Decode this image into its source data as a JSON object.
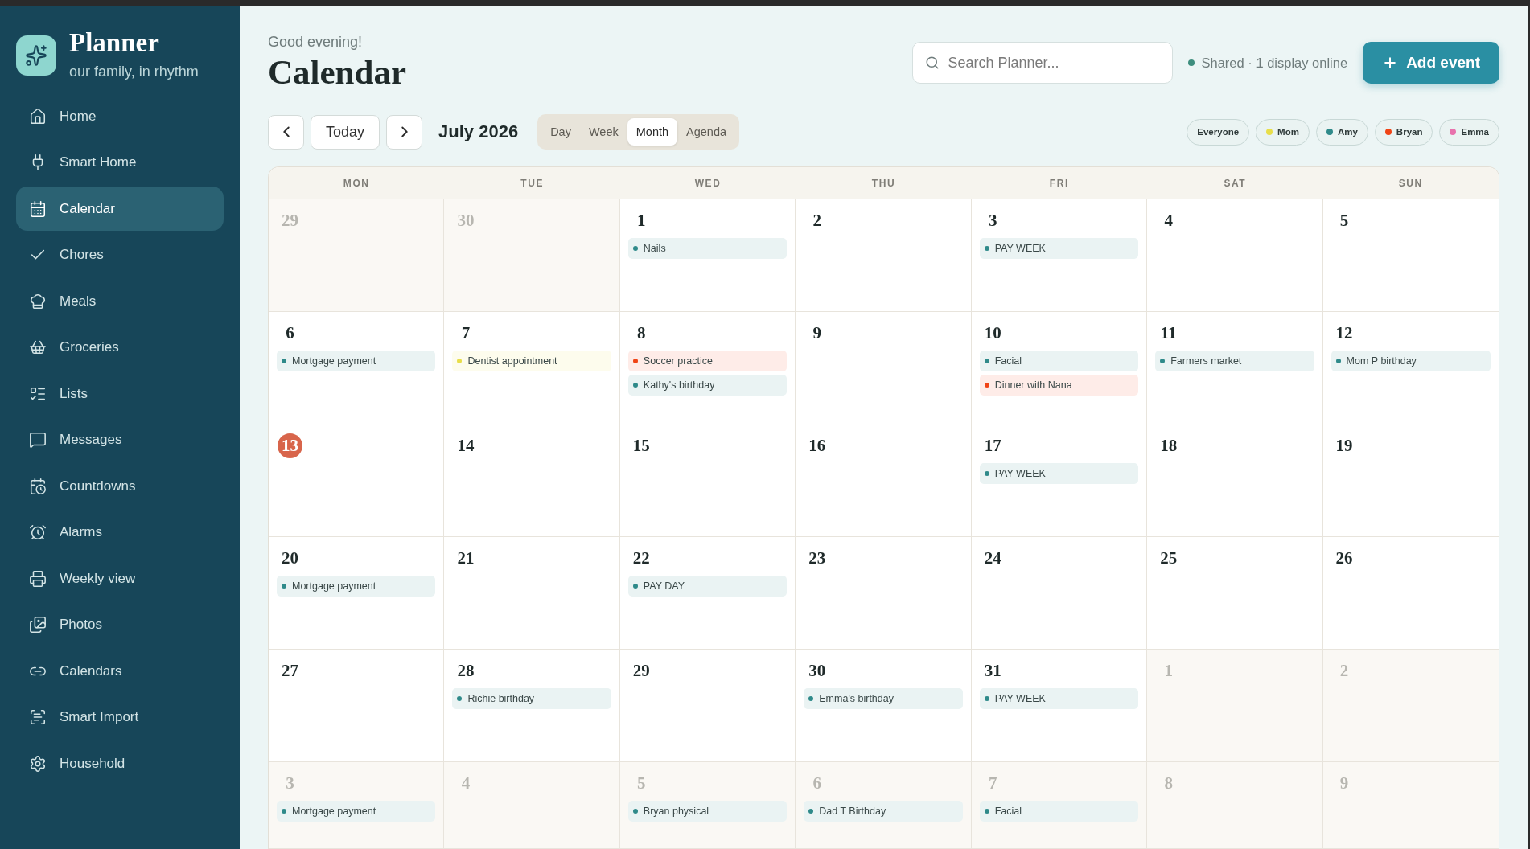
{
  "sidebar": {
    "title": "Planner",
    "tagline": "our family, in rhythm",
    "items": [
      {
        "label": "Home",
        "selected": false
      },
      {
        "label": "Smart Home",
        "selected": false
      },
      {
        "label": "Calendar",
        "selected": true
      },
      {
        "label": "Chores",
        "selected": false
      },
      {
        "label": "Meals",
        "selected": false
      },
      {
        "label": "Groceries",
        "selected": false
      },
      {
        "label": "Lists",
        "selected": false
      },
      {
        "label": "Messages",
        "selected": false
      },
      {
        "label": "Countdowns",
        "selected": false
      },
      {
        "label": "Alarms",
        "selected": false
      },
      {
        "label": "Weekly view",
        "selected": false
      },
      {
        "label": "Photos",
        "selected": false
      },
      {
        "label": "Calendars",
        "selected": false
      },
      {
        "label": "Smart Import",
        "selected": false
      },
      {
        "label": "Household",
        "selected": false
      }
    ]
  },
  "header": {
    "greeting": "Good evening!",
    "title": "Calendar",
    "search": {
      "placeholder": "Search Planner..."
    },
    "status": "Shared · 1 display online",
    "add_button": "Add event"
  },
  "toolbar": {
    "today_button": "Today",
    "month": "July 2026",
    "views": [
      {
        "label": "Day",
        "selected": false
      },
      {
        "label": "Week",
        "selected": false
      },
      {
        "label": "Month",
        "selected": true
      },
      {
        "label": "Agenda",
        "selected": false
      }
    ],
    "filters": [
      {
        "label": "Everyone"
      },
      {
        "label": "Mom",
        "color": "#e8de4a"
      },
      {
        "label": "Amy",
        "color": "#2f8a8a"
      },
      {
        "label": "Bryan",
        "color": "#f04416"
      },
      {
        "label": "Emma",
        "color": "#e872ad"
      }
    ]
  },
  "calendar": {
    "weekdays": [
      "MON",
      "TUE",
      "WED",
      "THU",
      "FRI",
      "SAT",
      "SUN"
    ],
    "weeks": [
      {
        "days": [
          {
            "day": "29",
            "outside": true,
            "today": false
          },
          {
            "day": "30",
            "outside": true,
            "today": false
          },
          {
            "day": "1",
            "outside": false,
            "today": false,
            "events": [
              {
                "title": "Nails",
                "color": "#2f8a8a"
              }
            ]
          },
          {
            "day": "2",
            "outside": false,
            "today": false
          },
          {
            "day": "3",
            "outside": false,
            "today": false,
            "events": [
              {
                "title": "PAY WEEK",
                "color": "#2f8a8a"
              }
            ]
          },
          {
            "day": "4",
            "outside": false,
            "today": false
          },
          {
            "day": "5",
            "outside": false,
            "today": false
          }
        ]
      },
      {
        "days": [
          {
            "day": "6",
            "outside": false,
            "today": false,
            "events": [
              {
                "title": "Mortgage payment",
                "color": "#2f8a8a"
              }
            ]
          },
          {
            "day": "7",
            "outside": false,
            "today": false,
            "events": [
              {
                "title": "Dentist appointment",
                "color": "#e8de4a"
              }
            ]
          },
          {
            "day": "8",
            "outside": false,
            "today": false,
            "events": [
              {
                "title": "Soccer practice",
                "color": "#f04416"
              },
              {
                "title": "Kathy's birthday",
                "color": "#2f8a8a"
              }
            ]
          },
          {
            "day": "9",
            "outside": false,
            "today": false
          },
          {
            "day": "10",
            "outside": false,
            "today": false,
            "events": [
              {
                "title": "Facial",
                "color": "#2f8a8a"
              },
              {
                "title": "Dinner with Nana",
                "color": "#f04416"
              }
            ]
          },
          {
            "day": "11",
            "outside": false,
            "today": false,
            "events": [
              {
                "title": "Farmers market",
                "color": "#2f8a8a"
              }
            ]
          },
          {
            "day": "12",
            "outside": false,
            "today": false,
            "events": [
              {
                "title": "Mom P birthday",
                "color": "#2f8a8a"
              }
            ]
          }
        ]
      },
      {
        "days": [
          {
            "day": "13",
            "outside": false,
            "today": true
          },
          {
            "day": "14",
            "outside": false,
            "today": false
          },
          {
            "day": "15",
            "outside": false,
            "today": false
          },
          {
            "day": "16",
            "outside": false,
            "today": false
          },
          {
            "day": "17",
            "outside": false,
            "today": false,
            "events": [
              {
                "title": "PAY WEEK",
                "color": "#2f8a8a"
              }
            ]
          },
          {
            "day": "18",
            "outside": false,
            "today": false
          },
          {
            "day": "19",
            "outside": false,
            "today": false
          }
        ]
      },
      {
        "days": [
          {
            "day": "20",
            "outside": false,
            "today": false,
            "events": [
              {
                "title": "Mortgage payment",
                "color": "#2f8a8a"
              }
            ]
          },
          {
            "day": "21",
            "outside": false,
            "today": false
          },
          {
            "day": "22",
            "outside": false,
            "today": false,
            "events": [
              {
                "title": "PAY DAY",
                "color": "#2f8a8a"
              }
            ]
          },
          {
            "day": "23",
            "outside": false,
            "today": false
          },
          {
            "day": "24",
            "outside": false,
            "today": false
          },
          {
            "day": "25",
            "outside": false,
            "today": false
          },
          {
            "day": "26",
            "outside": false,
            "today": false
          }
        ]
      },
      {
        "days": [
          {
            "day": "27",
            "outside": false,
            "today": false
          },
          {
            "day": "28",
            "outside": false,
            "today": false,
            "events": [
              {
                "title": "Richie birthday",
                "color": "#2f8a8a"
              }
            ]
          },
          {
            "day": "29",
            "outside": false,
            "today": false
          },
          {
            "day": "30",
            "outside": false,
            "today": false,
            "events": [
              {
                "title": "Emma's birthday",
                "color": "#2f8a8a"
              }
            ]
          },
          {
            "day": "31",
            "outside": false,
            "today": false,
            "events": [
              {
                "title": "PAY WEEK",
                "color": "#2f8a8a"
              }
            ]
          },
          {
            "day": "1",
            "outside": true,
            "today": false
          },
          {
            "day": "2",
            "outside": true,
            "today": false
          }
        ]
      },
      {
        "days": [
          {
            "day": "3",
            "outside": true,
            "today": false,
            "events": [
              {
                "title": "Mortgage payment",
                "color": "#2f8a8a"
              }
            ]
          },
          {
            "day": "4",
            "outside": true,
            "today": false
          },
          {
            "day": "5",
            "outside": true,
            "today": false,
            "events": [
              {
                "title": "Bryan physical",
                "color": "#2f8a8a"
              }
            ]
          },
          {
            "day": "6",
            "outside": true,
            "today": false,
            "events": [
              {
                "title": "Dad T Birthday",
                "color": "#2f8a8a"
              }
            ]
          },
          {
            "day": "7",
            "outside": true,
            "today": false,
            "events": [
              {
                "title": "Facial",
                "color": "#2f8a8a"
              }
            ]
          },
          {
            "day": "8",
            "outside": true,
            "today": false
          },
          {
            "day": "9",
            "outside": true,
            "today": false
          }
        ]
      }
    ]
  }
}
